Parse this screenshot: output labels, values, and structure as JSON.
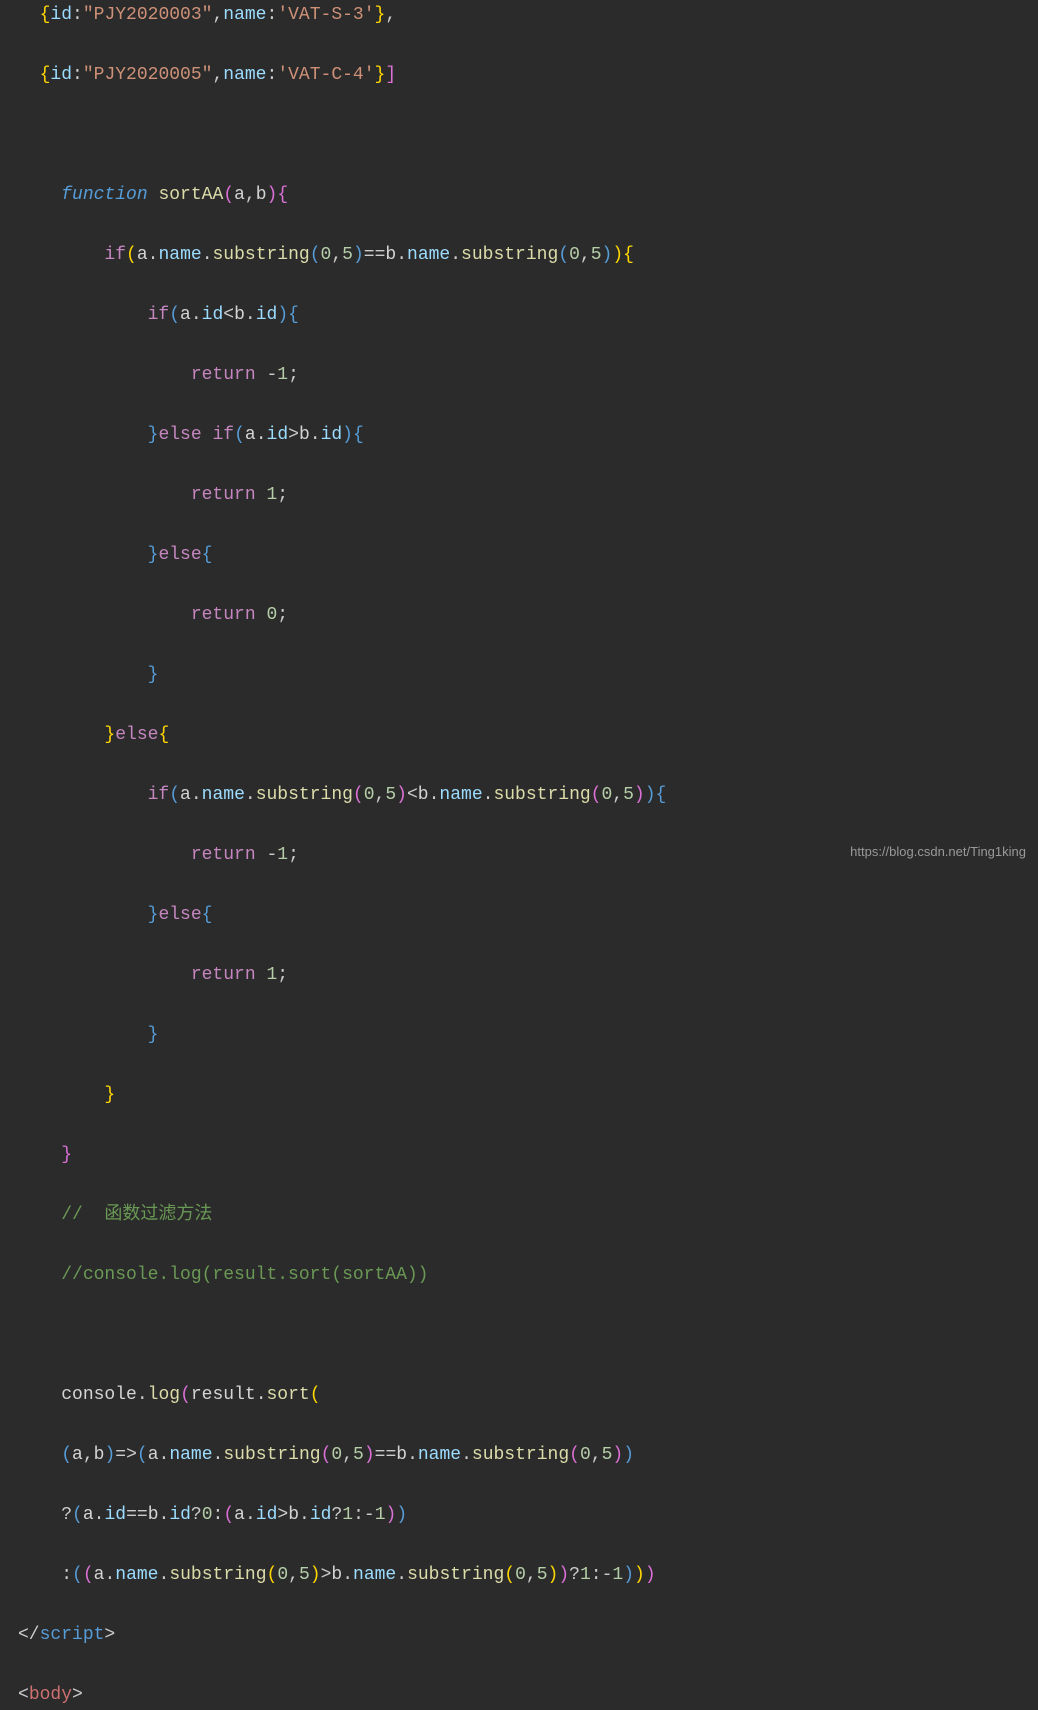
{
  "code": {
    "line1_id": "\"PJY2020003\"",
    "line1_name": "'VAT-S-3'",
    "line2_id": "\"PJY2020005\"",
    "line2_name": "'VAT-C-4'",
    "func_keyword": "function",
    "func_name": "sortAA",
    "params": "a,b",
    "if_kw": "if",
    "else_kw": "else",
    "return_kw": "return",
    "substring": "substring",
    "name_prop": "name",
    "id_prop": "id",
    "num0": "0",
    "num5": "5",
    "num1": "1",
    "neg1": "-1",
    "comment1": "//  函数过滤方法",
    "comment2": "//console.log(result.sort(sortAA))",
    "console": "console",
    "log": "log",
    "result": "result",
    "sort": "sort",
    "script_tag": "script",
    "body_tag": "body"
  },
  "watermark": "https://blog.csdn.net/Ting1king"
}
